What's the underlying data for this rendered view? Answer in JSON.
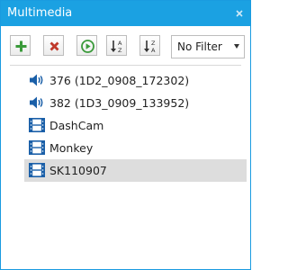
{
  "window": {
    "title": "Multimedia",
    "close_icon": "close-icon"
  },
  "toolbar": {
    "buttons": [
      {
        "name": "add",
        "icon": "plus-icon",
        "color": "#3a9a3a"
      },
      {
        "name": "delete",
        "icon": "x-icon",
        "color": "#c0392b"
      },
      {
        "name": "play",
        "icon": "play-circle-icon",
        "color": "#3a9a3a"
      },
      {
        "name": "sort-ascending",
        "icon": "sort-az-icon"
      },
      {
        "name": "sort-descending",
        "icon": "sort-za-icon"
      }
    ],
    "filter": {
      "selected": "No Filter"
    }
  },
  "items": [
    {
      "label": "376 (1D2_0908_172302)",
      "icon": "audio-icon",
      "selected": false
    },
    {
      "label": "382 (1D3_0909_133952)",
      "icon": "audio-icon",
      "selected": false
    },
    {
      "label": "DashCam",
      "icon": "film-icon",
      "selected": false
    },
    {
      "label": "Monkey",
      "icon": "film-icon",
      "selected": false
    },
    {
      "label": "SK110907",
      "icon": "film-icon",
      "selected": true
    }
  ],
  "colors": {
    "title_bar": "#1ba1e2",
    "selection": "#dddddd",
    "icon_blue": "#1a5fa8"
  }
}
